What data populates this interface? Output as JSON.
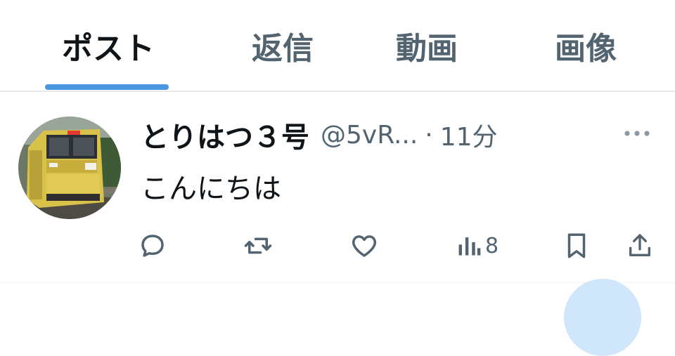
{
  "tabs": [
    {
      "label": "ポスト",
      "active": true
    },
    {
      "label": "返信",
      "active": false
    },
    {
      "label": "動画",
      "active": false
    },
    {
      "label": "画像",
      "active": false
    }
  ],
  "colors": {
    "accent": "#4a97e0",
    "text": "#0f1419",
    "muted": "#536471",
    "divider": "#e7e9ea"
  },
  "post": {
    "display_name": "とりはつ３号",
    "handle": "@5vR...",
    "separator": "·",
    "time": "11分",
    "text": "こんにちは",
    "avatar_icon": "train-photo-avatar",
    "more_icon": "more-dots-icon",
    "actions": {
      "reply_icon": "reply-icon",
      "repost_icon": "repost-icon",
      "like_icon": "like-icon",
      "views_icon": "views-icon",
      "views_count": "8",
      "bookmark_icon": "bookmark-icon",
      "share_icon": "share-icon"
    }
  }
}
